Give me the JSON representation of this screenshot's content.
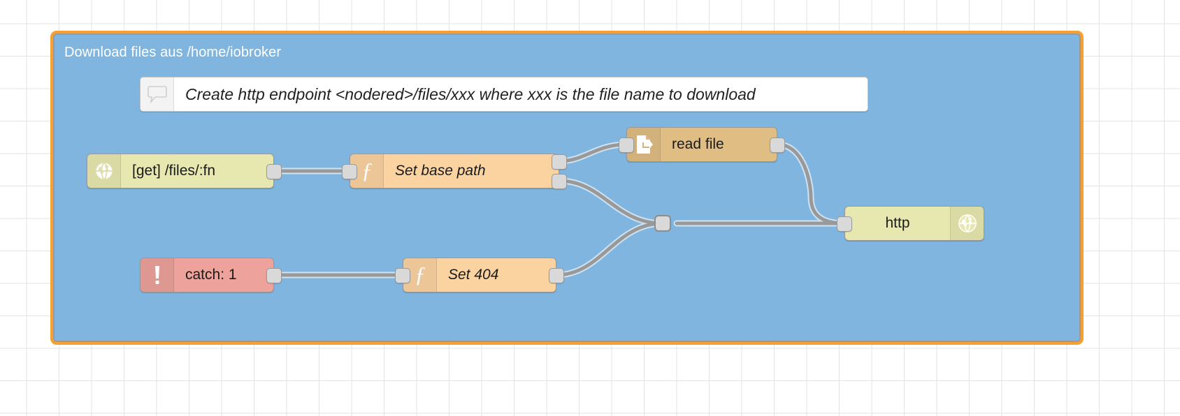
{
  "editor": {
    "app": "Node-RED flow editor",
    "canvas_background": "#ffffff",
    "grid_color": "#e3e3e3"
  },
  "group": {
    "title": "Download files aus /home/iobroker",
    "fill": "#7fb5de",
    "border": "#9a9a9a",
    "selection_color": "#f5a030"
  },
  "comment": {
    "text": "Create http endpoint <nodered>/files/xxx where xxx is the file name to download",
    "icon": "comment-bubble-icon"
  },
  "nodes": [
    {
      "id": "http-in",
      "label": "[get] /files/:fn",
      "type": "http in",
      "icon": "globe-icon",
      "color": "#e7e8af",
      "inputs": 0,
      "outputs": 1
    },
    {
      "id": "set-base-path",
      "label": "Set base path",
      "type": "function",
      "icon": "function-f-icon",
      "color": "#fbd3a1",
      "inputs": 1,
      "outputs": 2
    },
    {
      "id": "read-file",
      "label": "read file",
      "type": "file in",
      "icon": "file-read-icon",
      "color": "#e0bd83",
      "inputs": 1,
      "outputs": 1
    },
    {
      "id": "catch",
      "label": "catch: 1",
      "type": "catch",
      "icon": "exclamation-icon",
      "color": "#eda29b",
      "inputs": 0,
      "outputs": 1
    },
    {
      "id": "set-404",
      "label": "Set 404",
      "type": "function",
      "icon": "function-f-icon",
      "color": "#fbd3a1",
      "inputs": 1,
      "outputs": 1
    },
    {
      "id": "http-response",
      "label": "http",
      "type": "http response",
      "icon": "globe-icon",
      "color": "#e7e8af",
      "inputs": 1,
      "outputs": 0
    }
  ],
  "junction": {
    "name": "wire-junction"
  },
  "wire_color": "#999999",
  "wire_halo": "#cfe2f1"
}
